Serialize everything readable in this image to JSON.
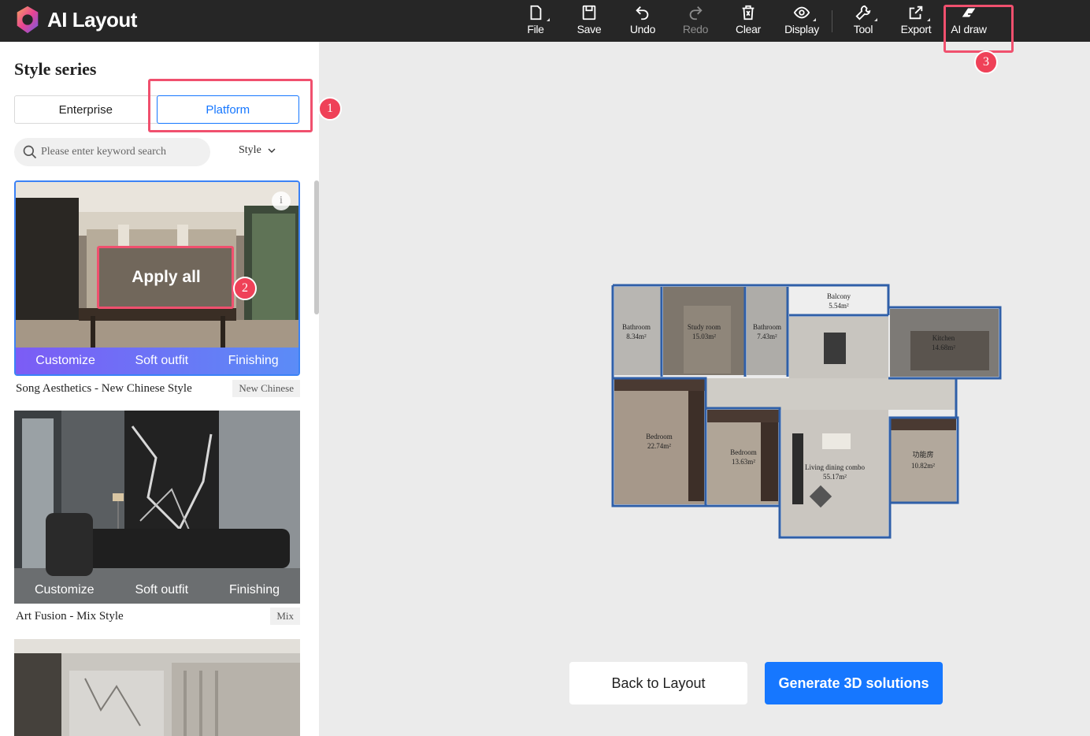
{
  "app": {
    "title": "AI Layout"
  },
  "toolbar": {
    "file": "File",
    "save": "Save",
    "undo": "Undo",
    "redo": "Redo",
    "clear": "Clear",
    "display": "Display",
    "tool": "Tool",
    "export": "Export",
    "ai_draw": "AI draw"
  },
  "sidebar": {
    "title": "Style series",
    "tabs": [
      {
        "label": "Enterprise",
        "active": false
      },
      {
        "label": "Platform",
        "active": true
      }
    ],
    "search_placeholder": "Please enter keyword search",
    "style_filter": "Style",
    "cards": [
      {
        "name": "Song Aesthetics - New Chinese Style",
        "tag": "New Chinese",
        "apply_all": "Apply all",
        "info": "i",
        "actions": [
          "Customize",
          "Soft outfit",
          "Finishing"
        ]
      },
      {
        "name": "Art Fusion - Mix Style",
        "tag": "Mix",
        "actions": [
          "Customize",
          "Soft outfit",
          "Finishing"
        ]
      },
      {
        "name": "",
        "tag": ""
      }
    ]
  },
  "annotations": {
    "m1": "1",
    "m2": "2",
    "m3": "3",
    "color": "#f0506e"
  },
  "floorplan": {
    "rooms": [
      {
        "name": "Bathroom",
        "area": "8.34m²"
      },
      {
        "name": "Study room",
        "area": "15.03m²"
      },
      {
        "name": "Bathroom",
        "area": "7.43m²"
      },
      {
        "name": "Balcony",
        "area": "5.54m²"
      },
      {
        "name": "Kitchen",
        "area": "14.68m²"
      },
      {
        "name": "Bedroom",
        "area": "22.74m²"
      },
      {
        "name": "Bedroom",
        "area": "13.63m²"
      },
      {
        "name": "Living dining combo",
        "area": "55.17m²"
      },
      {
        "name": "功能房",
        "area": "10.82m²"
      }
    ]
  },
  "footer": {
    "back": "Back to Layout",
    "generate": "Generate 3D solutions"
  },
  "colors": {
    "topbar": "#262626",
    "primary": "#1677ff",
    "canvas": "#ebebeb",
    "wall": "#2f5fa8"
  }
}
